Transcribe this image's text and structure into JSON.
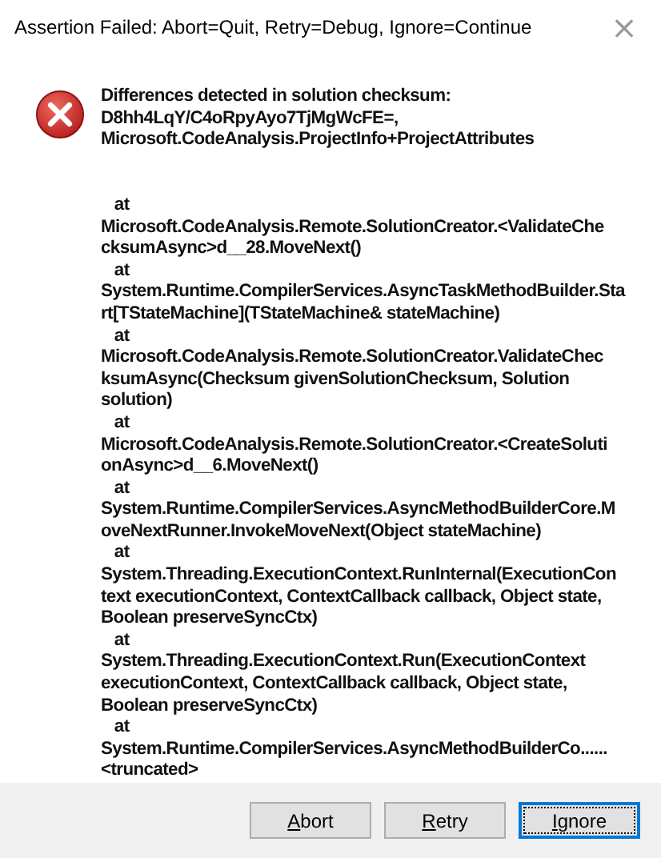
{
  "window": {
    "title": "Assertion Failed: Abort=Quit, Retry=Debug, Ignore=Continue",
    "close": "×"
  },
  "message": "Differences detected in solution checksum:\nD8hh4LqY/C4oRpyAyo7TjMgWcFE=,\nMicrosoft.CodeAnalysis.ProjectInfo+ProjectAttributes\n\n\n   at\nMicrosoft.CodeAnalysis.Remote.SolutionCreator.<ValidateChe\ncksumAsync>d__28.MoveNext()\n   at\nSystem.Runtime.CompilerServices.AsyncTaskMethodBuilder.Sta\nrt[TStateMachine](TStateMachine& stateMachine)\n   at\nMicrosoft.CodeAnalysis.Remote.SolutionCreator.ValidateChec\nksumAsync(Checksum givenSolutionChecksum, Solution\nsolution)\n   at\nMicrosoft.CodeAnalysis.Remote.SolutionCreator.<CreateSoluti\nonAsync>d__6.MoveNext()\n   at\nSystem.Runtime.CompilerServices.AsyncMethodBuilderCore.M\noveNextRunner.InvokeMoveNext(Object stateMachine)\n   at\nSystem.Threading.ExecutionContext.RunInternal(ExecutionCon\ntext executionContext, ContextCallback callback, Object state,\nBoolean preserveSyncCtx)\n   at\nSystem.Threading.ExecutionContext.Run(ExecutionContext\nexecutionContext, ContextCallback callback, Object state,\nBoolean preserveSyncCtx)\n   at\nSystem.Runtime.CompilerServices.AsyncMethodBuilderCo......\n<truncated>",
  "buttons": [
    {
      "label": "Abort",
      "focused": false
    },
    {
      "label": "Retry",
      "focused": false
    },
    {
      "label": "Ignore",
      "focused": true
    }
  ]
}
